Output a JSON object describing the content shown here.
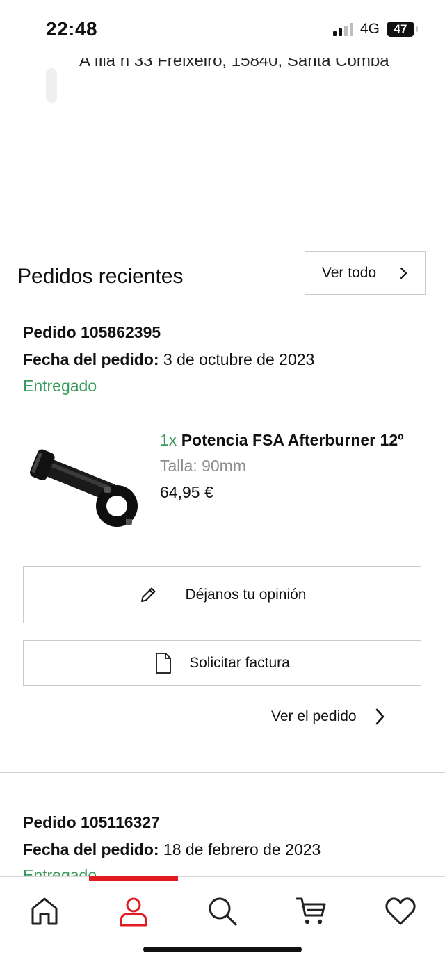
{
  "status_bar": {
    "time": "22:48",
    "network": "4G",
    "battery": "47"
  },
  "address_fragment": "A Illa n 33 Freixeiro, 15840, Santa Comba",
  "recent_orders": {
    "title": "Pedidos recientes",
    "view_all_label": "Ver todo"
  },
  "orders": [
    {
      "id_text": "Pedido 105862395",
      "date_label": "Fecha del pedido:",
      "date_value": "3 de octubre de 2023",
      "status": "Entregado",
      "item": {
        "qty": "1x",
        "name": "Potencia FSA Afterburner 12º",
        "size": "Talla: 90mm",
        "price": "64,95 €"
      },
      "review_label": "Déjanos tu opinión",
      "invoice_label": "Solicitar factura",
      "view_order_label": "Ver el pedido"
    },
    {
      "id_text": "Pedido 105116327",
      "date_label": "Fecha del pedido:",
      "date_value": "18 de febrero de 2023",
      "status": "Entregado"
    }
  ],
  "colors": {
    "accent": "#e21b23",
    "status_green": "#3a9a5b",
    "muted": "#8c8c8c"
  },
  "bottom_nav": [
    {
      "icon": "home-icon",
      "active": false
    },
    {
      "icon": "user-icon",
      "active": true
    },
    {
      "icon": "search-icon",
      "active": false
    },
    {
      "icon": "cart-icon",
      "active": false
    },
    {
      "icon": "heart-icon",
      "active": false
    }
  ]
}
